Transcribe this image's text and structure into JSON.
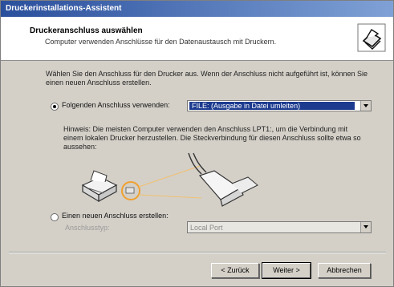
{
  "window": {
    "title": "Druckerinstallations-Assistent"
  },
  "header": {
    "title": "Druckeranschluss auswählen",
    "subtitle": "Computer verwenden Anschlüsse für den Datenaustausch mit Druckern."
  },
  "intro_text": "Wählen Sie den Anschluss für den Drucker aus. Wenn der Anschluss nicht aufgeführt ist, können Sie einen neuen Anschluss erstellen.",
  "option_existing": {
    "label": "Folgenden Anschluss verwenden:",
    "checked": true,
    "selected_value": "FILE: (Ausgabe in Datei umleiten)"
  },
  "hint_text": "Hinweis: Die meisten Computer verwenden den Anschluss LPT1:, um die Verbindung mit einem lokalen Drucker herzustellen. Die Steckverbindung für diesen Anschluss sollte etwa so aussehen:",
  "option_new": {
    "label": "Einen neuen Anschluss erstellen:",
    "checked": false,
    "type_label": "Anschlusstyp:",
    "selected_value": "Local Port"
  },
  "buttons": {
    "back": "< Zurück",
    "next": "Weiter >",
    "cancel": "Abbrechen"
  }
}
